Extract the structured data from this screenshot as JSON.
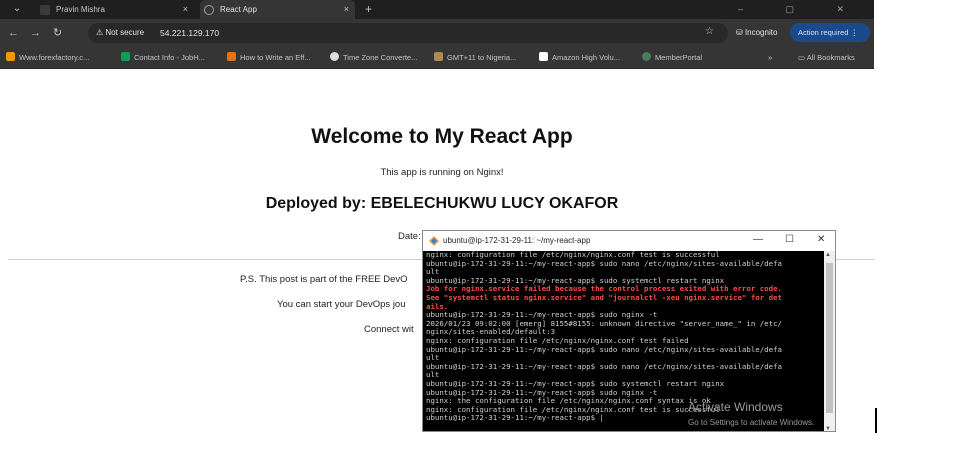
{
  "browser": {
    "tabs": [
      {
        "title": "Pravin Mishra"
      },
      {
        "title": "React App"
      }
    ],
    "new_tab": "+",
    "close_glyph": "×",
    "address": {
      "security_label": "Not secure",
      "url": "54.221.129.170"
    },
    "incognito_label": "Incognito",
    "action_label": "Action required",
    "bookmarks": [
      {
        "label": "Www.forexfactory.c...",
        "color": "#f29900"
      },
      {
        "label": "Contact Info - JobH...",
        "color": "#0f9d58"
      },
      {
        "label": "How to Write an Eff...",
        "color": "#e8710a"
      },
      {
        "label": "Time Zone Converte...",
        "color": "#dddddd"
      },
      {
        "label": "GMT+11 to Nigeria...",
        "color": "#b0894f"
      },
      {
        "label": "Amazon High Volu...",
        "color": "#ffffff"
      },
      {
        "label": "MemberPortal",
        "color": "#4a7c59"
      }
    ],
    "all_bookmarks": "All Bookmarks",
    "overflow": "»"
  },
  "page": {
    "heading": "Welcome to My React App",
    "subheading": "This app is running on Nginx!",
    "deployed_by": "Deployed by: EBELECHUKWU LUCY OKAFOR",
    "date_label": "Date:",
    "ps_text": "P.S. This post is part of the FREE DevO",
    "start_text": "You can start your DevOps jou",
    "connect_text": "Connect wit"
  },
  "terminal": {
    "title": "ubuntu@ip-172-31-29-11: ~/my-react-app",
    "lines": [
      {
        "t": "nginx: configuration file /etc/nginx/nginx.conf test is successful",
        "err": false
      },
      {
        "t": "ubuntu@ip-172-31-29-11:~/my-react-app$ sudo nano /etc/nginx/sites-available/defa",
        "err": false
      },
      {
        "t": "ult",
        "err": false
      },
      {
        "t": "ubuntu@ip-172-31-29-11:~/my-react-app$ sudo systemctl restart nginx",
        "err": false
      },
      {
        "t": "Job for nginx.service failed because the control process exited with error code.",
        "err": true
      },
      {
        "t": "See \"systemctl status nginx.service\" and \"journalctl -xeu nginx.service\" for det",
        "err": true
      },
      {
        "t": "ails.",
        "err": true
      },
      {
        "t": "ubuntu@ip-172-31-29-11:~/my-react-app$ sudo nginx -t",
        "err": false
      },
      {
        "t": "2026/01/23 09:02:00 [emerg] 8155#8155: unknown directive \"server_name_\" in /etc/",
        "err": false
      },
      {
        "t": "nginx/sites-enabled/default:3",
        "err": false
      },
      {
        "t": "nginx: configuration file /etc/nginx/nginx.conf test failed",
        "err": false
      },
      {
        "t": "ubuntu@ip-172-31-29-11:~/my-react-app$ sudo nano /etc/nginx/sites-available/defa",
        "err": false
      },
      {
        "t": "ult",
        "err": false
      },
      {
        "t": "ubuntu@ip-172-31-29-11:~/my-react-app$ sudo nano /etc/nginx/sites-available/defa",
        "err": false
      },
      {
        "t": "ult",
        "err": false
      },
      {
        "t": "ubuntu@ip-172-31-29-11:~/my-react-app$ sudo systemctl restart nginx",
        "err": false
      },
      {
        "t": "ubuntu@ip-172-31-29-11:~/my-react-app$ sudo nginx -t",
        "err": false
      },
      {
        "t": "nginx: the configuration file /etc/nginx/nginx.conf syntax is ok",
        "err": false
      },
      {
        "t": "nginx: configuration file /etc/nginx/nginx.conf test is successful",
        "err": false
      },
      {
        "t": "ubuntu@ip-172-31-29-11:~/my-react-app$ |",
        "err": false
      }
    ]
  },
  "activation": {
    "title": "Activate Windows",
    "subtitle": "Go to Settings to activate Windows."
  }
}
